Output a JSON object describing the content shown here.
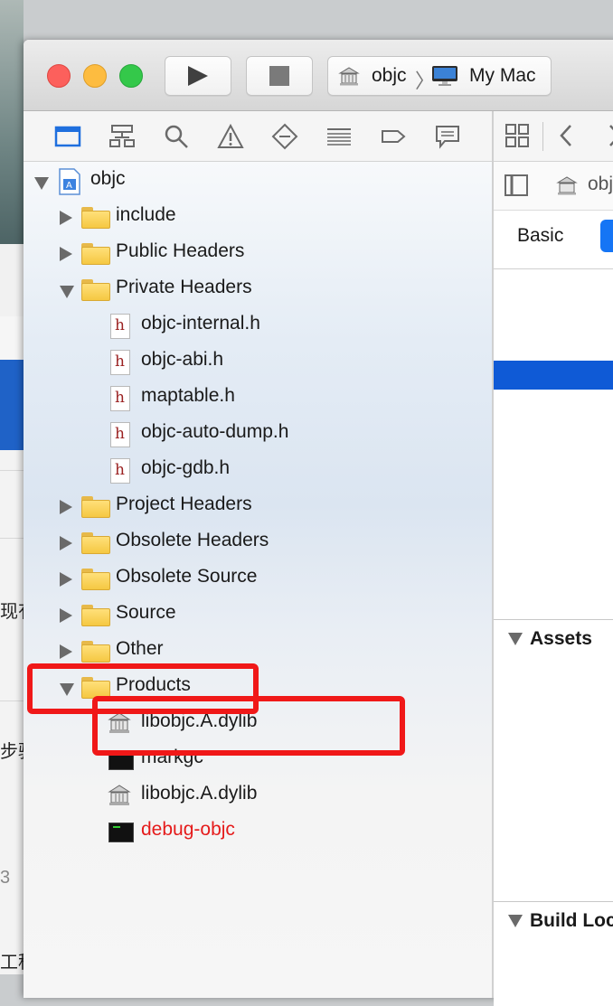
{
  "background": {
    "text_1": "现有",
    "text_2": "步骤",
    "text_3": "3",
    "text_4": "工程"
  },
  "toolbar": {
    "scheme_target": "objc",
    "destination": "My Mac"
  },
  "navigator": {
    "icons": [
      "folder-icon",
      "hierarchy-icon",
      "search-icon",
      "warning-icon",
      "breakpoint-icon",
      "list-icon",
      "tag-icon",
      "message-icon"
    ]
  },
  "tree": {
    "project": "objc",
    "include": "include",
    "public_headers": "Public Headers",
    "private_headers": "Private Headers",
    "files": [
      "objc-internal.h",
      "objc-abi.h",
      "maptable.h",
      "objc-auto-dump.h",
      "objc-gdb.h"
    ],
    "project_headers": "Project Headers",
    "obsolete_headers": "Obsolete Headers",
    "obsolete_source": "Obsolete Source",
    "source": "Source",
    "other": "Other",
    "products": "Products",
    "product_items": [
      "libobjc.A.dylib",
      "markgc",
      "libobjc.A.dylib",
      "debug-objc"
    ]
  },
  "inspector": {
    "breadcrumb": "obj",
    "tab_basic": "Basic",
    "assets": "Assets",
    "build_locations": "Build Loc"
  },
  "colors": {
    "highlight": "#f01818",
    "missing_product": "#e51b1b",
    "selection": "#0f5ad6"
  }
}
